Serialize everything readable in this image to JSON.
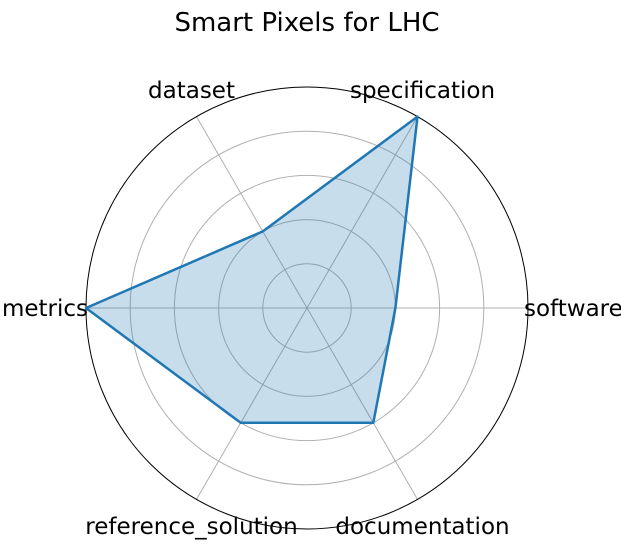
{
  "chart_data": {
    "type": "radar",
    "title": "Smart Pixels for LHC",
    "categories": [
      "software",
      "specification",
      "dataset",
      "metrics",
      "reference_solution",
      "documentation"
    ],
    "values": [
      2,
      5,
      2,
      5,
      3,
      3
    ],
    "rlim": [
      0,
      5
    ],
    "rgrid": [
      1,
      2,
      3,
      4,
      5
    ],
    "grid": true,
    "legend": "none",
    "colors": {
      "line": "#1f77b4",
      "fill": "#1f77b4",
      "grid": "#b0b0b0",
      "frame": "#000000"
    }
  }
}
